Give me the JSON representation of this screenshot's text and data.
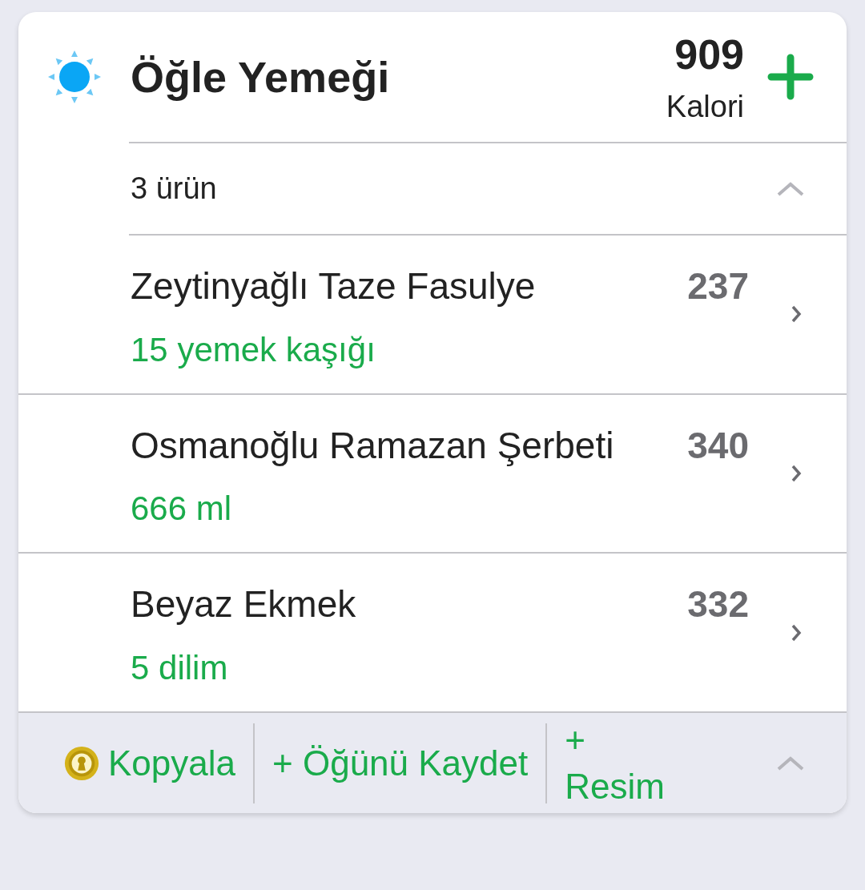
{
  "meal": {
    "title": "Öğle Yemeği",
    "calories": "909",
    "calories_unit": "Kalori"
  },
  "summary": {
    "count": "3 ürün",
    "expanded": true
  },
  "items": [
    {
      "name": "Zeytinyağlı Taze Fasulye",
      "calories": "237",
      "portion": "15 yemek kaşığı"
    },
    {
      "name": "Osmanoğlu Ramazan Şerbeti",
      "calories": "340",
      "portion": "666 ml"
    },
    {
      "name": "Beyaz Ekmek",
      "calories": "332",
      "portion": "5 dilim"
    }
  ],
  "footer": {
    "actions": [
      "Kopyala",
      "+ Öğünü Kaydet",
      "+ Resim"
    ]
  }
}
